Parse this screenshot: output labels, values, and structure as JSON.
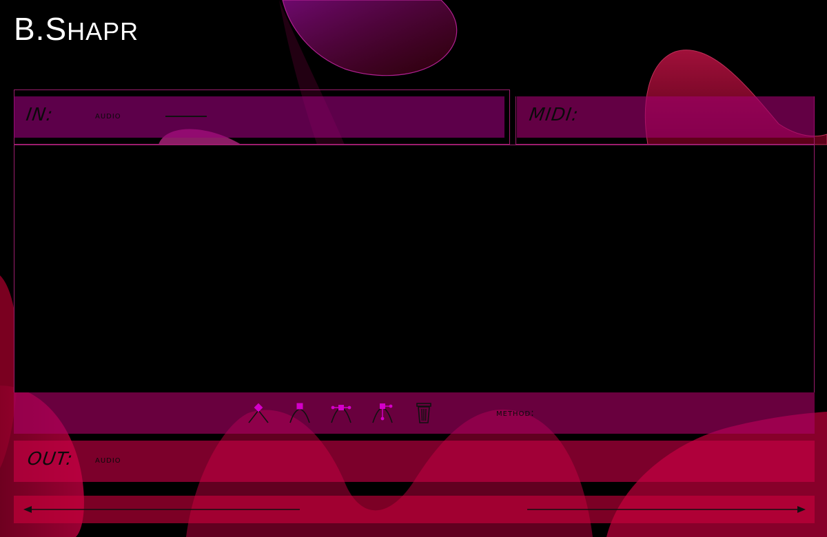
{
  "app": {
    "logo_prefix": "B.S",
    "logo_suffix": "hapr"
  },
  "input": {
    "header": "IN:",
    "source": "audio"
  },
  "midi": {
    "header": "MIDI:"
  },
  "toolbar": {
    "tools": [
      {
        "icon": "point-node-icon"
      },
      {
        "icon": "curve-node-icon"
      },
      {
        "icon": "smooth-node-icon"
      },
      {
        "icon": "symmetric-node-icon"
      },
      {
        "icon": "trash-icon"
      }
    ],
    "method_label": "method:"
  },
  "output": {
    "header": "OUT:",
    "target": "audio"
  },
  "colors": {
    "accent": "#d400c8",
    "panel_in": "#960078",
    "panel_out": "#c80046"
  }
}
